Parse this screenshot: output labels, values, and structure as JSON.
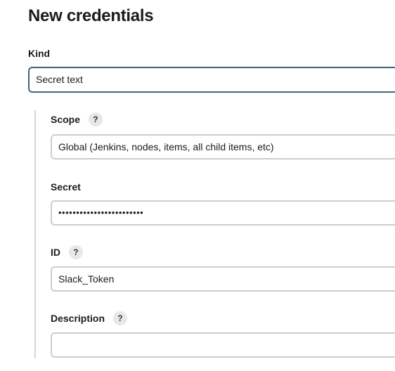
{
  "page": {
    "title": "New credentials"
  },
  "form": {
    "kind": {
      "label": "Kind",
      "value": "Secret text"
    },
    "scope": {
      "label": "Scope",
      "help": "?",
      "value": "Global (Jenkins, nodes, items, all child items, etc)"
    },
    "secret": {
      "label": "Secret",
      "value": "••••••••••••••••••••••••"
    },
    "id": {
      "label": "ID",
      "help": "?",
      "value": "Slack_Token"
    },
    "description": {
      "label": "Description",
      "help": "?",
      "value": ""
    }
  }
}
